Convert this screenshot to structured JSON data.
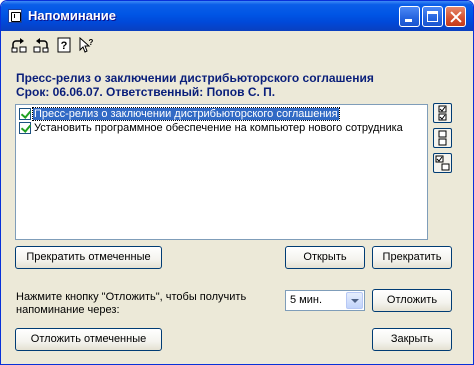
{
  "window": {
    "title": "Напоминание",
    "icon": "app-icon"
  },
  "toolbar": {
    "icons": [
      "forward-undo-icon",
      "back-undo-icon",
      "help-icon",
      "whats-this-icon"
    ]
  },
  "header": {
    "line1": "Пресс-релиз о заключении дистрибьюторского соглашения",
    "line2": "Срок: 06.06.07. Ответственный: Попов С. П."
  },
  "list": {
    "items": [
      {
        "label": "Пресс-релиз о заключении дистрибьюторского соглашения",
        "checked": true,
        "selected": true
      },
      {
        "label": "Установить программное обеспечение на компьютер нового сотрудника",
        "checked": true,
        "selected": false
      }
    ]
  },
  "side_buttons": [
    "check-all-icon",
    "uncheck-icon",
    "uncheck-all-icon"
  ],
  "buttons": {
    "stop_selected": "Прекратить отмеченные",
    "open": "Открыть",
    "stop": "Прекратить",
    "postpone": "Отложить",
    "postpone_selected": "Отложить отмеченные",
    "close": "Закрыть"
  },
  "postpone": {
    "prompt": "Нажмите кнопку \"Отложить\", чтобы получить напоминание через:",
    "selected": "5 мин."
  },
  "colors": {
    "titlebar": "#0055e5",
    "header_text": "#0a1f7a",
    "selection": "#316ac5",
    "window_bg": "#ece9d8"
  }
}
